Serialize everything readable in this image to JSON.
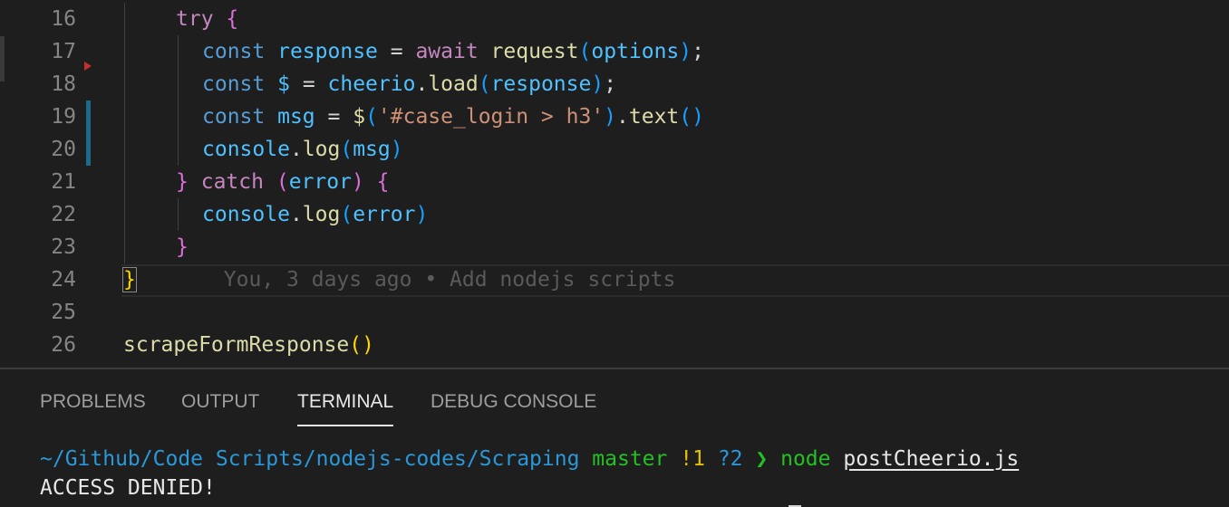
{
  "editor": {
    "lines": [
      {
        "num": "16",
        "tokens": [
          {
            "t": "try",
            "c": "k-ctrl"
          },
          {
            "t": " ",
            "c": "pl"
          },
          {
            "t": "{",
            "c": "brk2"
          }
        ]
      },
      {
        "num": "17",
        "tokens": [
          {
            "t": "const",
            "c": "k-decl"
          },
          {
            "t": " ",
            "c": "pl"
          },
          {
            "t": "response",
            "c": "var"
          },
          {
            "t": " = ",
            "c": "pl"
          },
          {
            "t": "await",
            "c": "k-ctrl"
          },
          {
            "t": " ",
            "c": "pl"
          },
          {
            "t": "request",
            "c": "fn"
          },
          {
            "t": "(",
            "c": "brk3"
          },
          {
            "t": "options",
            "c": "var"
          },
          {
            "t": ")",
            "c": "brk3"
          },
          {
            "t": ";",
            "c": "pl"
          }
        ]
      },
      {
        "num": "18",
        "tokens": [
          {
            "t": "const",
            "c": "k-decl"
          },
          {
            "t": " ",
            "c": "pl"
          },
          {
            "t": "$",
            "c": "var"
          },
          {
            "t": " = ",
            "c": "pl"
          },
          {
            "t": "cheerio",
            "c": "var"
          },
          {
            "t": ".",
            "c": "pl"
          },
          {
            "t": "load",
            "c": "fn"
          },
          {
            "t": "(",
            "c": "brk3"
          },
          {
            "t": "response",
            "c": "var"
          },
          {
            "t": ")",
            "c": "brk3"
          },
          {
            "t": ";",
            "c": "pl"
          }
        ]
      },
      {
        "num": "19",
        "tokens": [
          {
            "t": "const",
            "c": "k-decl"
          },
          {
            "t": " ",
            "c": "pl"
          },
          {
            "t": "msg",
            "c": "var"
          },
          {
            "t": " = ",
            "c": "pl"
          },
          {
            "t": "$",
            "c": "fn"
          },
          {
            "t": "(",
            "c": "brk3"
          },
          {
            "t": "'#case_login > h3'",
            "c": "str"
          },
          {
            "t": ")",
            "c": "brk3"
          },
          {
            "t": ".",
            "c": "pl"
          },
          {
            "t": "text",
            "c": "fn"
          },
          {
            "t": "()",
            "c": "brk3"
          }
        ]
      },
      {
        "num": "20",
        "tokens": [
          {
            "t": "console",
            "c": "var"
          },
          {
            "t": ".",
            "c": "pl"
          },
          {
            "t": "log",
            "c": "fn"
          },
          {
            "t": "(",
            "c": "brk3"
          },
          {
            "t": "msg",
            "c": "var"
          },
          {
            "t": ")",
            "c": "brk3"
          }
        ]
      },
      {
        "num": "21",
        "tokens": [
          {
            "t": "}",
            "c": "brk2"
          },
          {
            "t": " ",
            "c": "pl"
          },
          {
            "t": "catch",
            "c": "k-ctrl"
          },
          {
            "t": " ",
            "c": "pl"
          },
          {
            "t": "(",
            "c": "brk2"
          },
          {
            "t": "error",
            "c": "var"
          },
          {
            "t": ")",
            "c": "brk2"
          },
          {
            "t": " ",
            "c": "pl"
          },
          {
            "t": "{",
            "c": "brk2"
          }
        ]
      },
      {
        "num": "22",
        "tokens": [
          {
            "t": "console",
            "c": "var"
          },
          {
            "t": ".",
            "c": "pl"
          },
          {
            "t": "log",
            "c": "fn"
          },
          {
            "t": "(",
            "c": "brk3"
          },
          {
            "t": "error",
            "c": "var"
          },
          {
            "t": ")",
            "c": "brk3"
          }
        ]
      },
      {
        "num": "23",
        "tokens": [
          {
            "t": "}",
            "c": "brk2"
          }
        ]
      },
      {
        "num": "24",
        "tokens": [
          {
            "t": "}",
            "c": "brk1 brace-box"
          },
          {
            "t": "       You, 3 days ago • Add nodejs scripts",
            "c": "blame"
          }
        ]
      },
      {
        "num": "25",
        "tokens": []
      },
      {
        "num": "26",
        "tokens": [
          {
            "t": "scrapeFormResponse",
            "c": "fn"
          },
          {
            "t": "()",
            "c": "brk1"
          }
        ]
      }
    ]
  },
  "panel": {
    "tabs": [
      {
        "label": "PROBLEMS",
        "active": false
      },
      {
        "label": "OUTPUT",
        "active": false
      },
      {
        "label": "TERMINAL",
        "active": true
      },
      {
        "label": "DEBUG CONSOLE",
        "active": false
      }
    ],
    "terminal": {
      "path": "~/Github/Code Scripts/nodejs-codes/Scraping",
      "branch": "master",
      "modified": "!1",
      "untracked": "?2",
      "arrow": "❯",
      "command": "node",
      "file": "postCheerio.js",
      "output": "ACCESS DENIED!"
    }
  }
}
